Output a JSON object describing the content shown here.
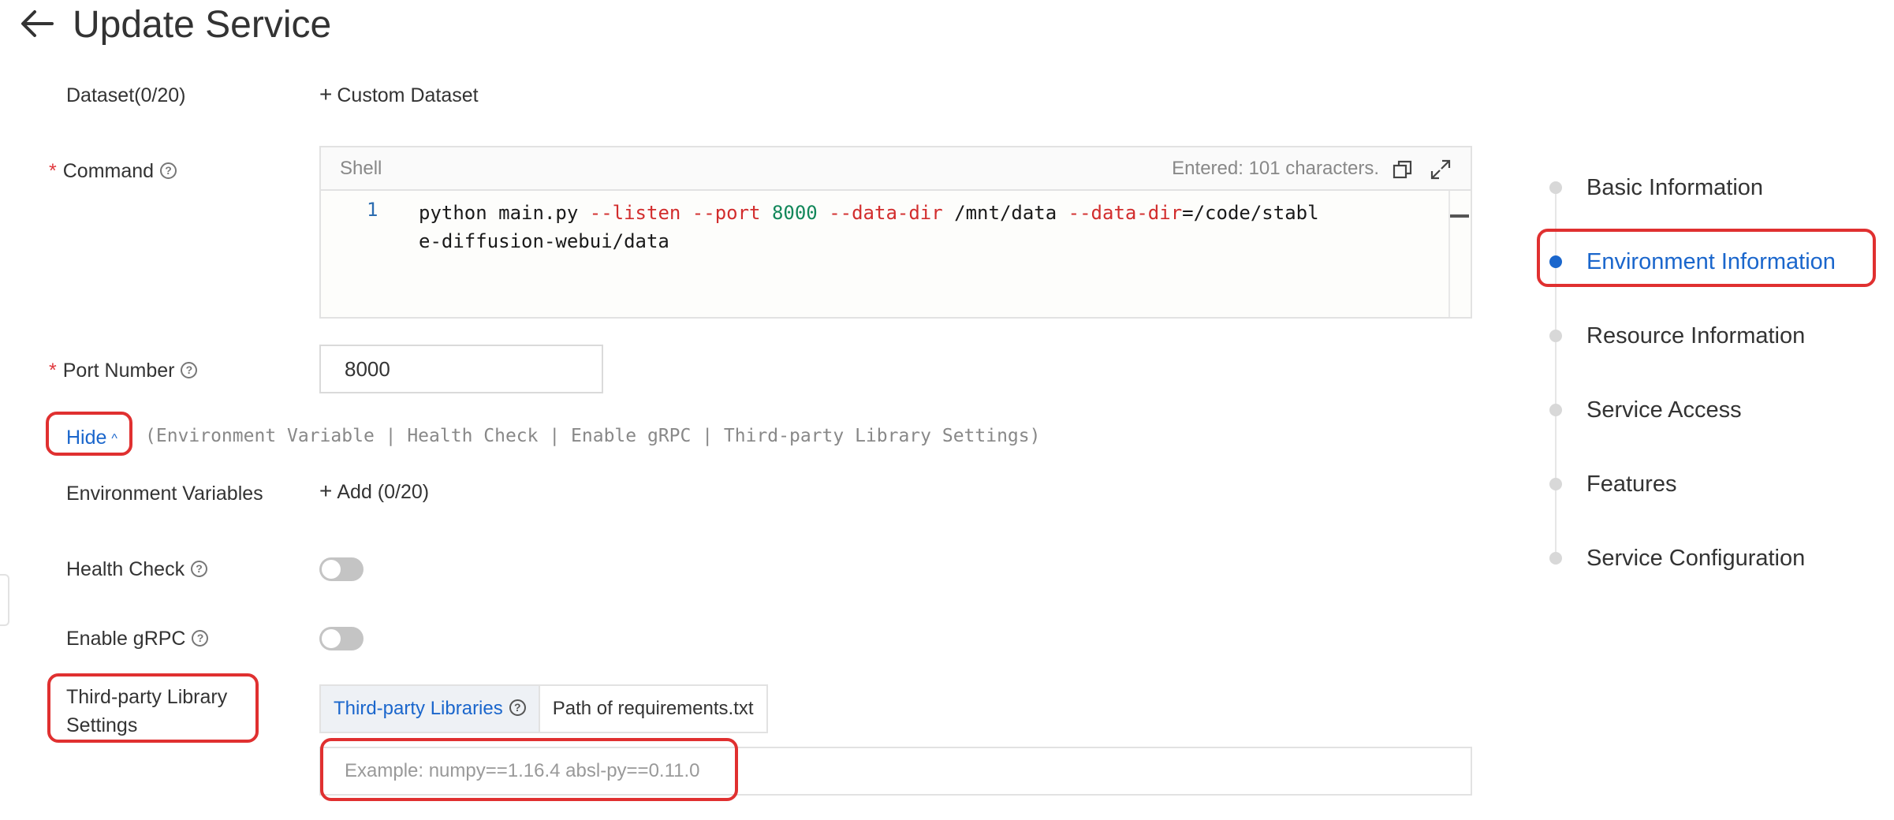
{
  "header": {
    "title": "Update Service"
  },
  "form": {
    "dataset": {
      "label": "Dataset(0/20)",
      "action": "Custom Dataset"
    },
    "command": {
      "label": "Command",
      "editor_lang": "Shell",
      "char_count": "Entered: 101 characters.",
      "line_number": "1",
      "tokens": {
        "t1": "python main.py ",
        "t2": "--listen",
        "t3": " ",
        "t4": "--port",
        "t5": " ",
        "t6": "8000",
        "t7": " ",
        "t8": "--data-dir",
        "t9": " /mnt/data ",
        "t10": "--data-dir",
        "t11": "=/code/stable-diffusion-webui/data"
      }
    },
    "port": {
      "label": "Port Number",
      "value": "8000"
    },
    "advanced": {
      "toggle_label": "Hide",
      "summary": "(Environment Variable | Health Check | Enable gRPC | Third-party Library Settings)"
    },
    "env_vars": {
      "label": "Environment Variables",
      "action": "Add (0/20)"
    },
    "health_check": {
      "label": "Health Check",
      "enabled": false
    },
    "grpc": {
      "label": "Enable gRPC",
      "enabled": false
    },
    "third_party": {
      "label_line1": "Third-party Library",
      "label_line2": "Settings",
      "tabs": [
        "Third-party Libraries",
        "Path of requirements.txt"
      ],
      "active_tab": "Third-party Libraries",
      "placeholder": "Example: numpy==1.16.4 absl-py==0.11.0"
    }
  },
  "anchor_nav": {
    "items": [
      {
        "label": "Basic Information",
        "active": false
      },
      {
        "label": "Environment Information",
        "active": true
      },
      {
        "label": "Resource Information",
        "active": false
      },
      {
        "label": "Service Access",
        "active": false
      },
      {
        "label": "Features",
        "active": false
      },
      {
        "label": "Service Configuration",
        "active": false
      }
    ]
  },
  "colors": {
    "accent": "#1a66cc",
    "required": "#e0393e",
    "annotation": "#e03030",
    "code_flag": "#d22d2d",
    "code_number": "#12875a"
  },
  "icons": [
    "back-arrow-icon",
    "help-circle-icon",
    "plus-icon",
    "copy-icon",
    "expand-icon",
    "chevron-up-icon"
  ]
}
